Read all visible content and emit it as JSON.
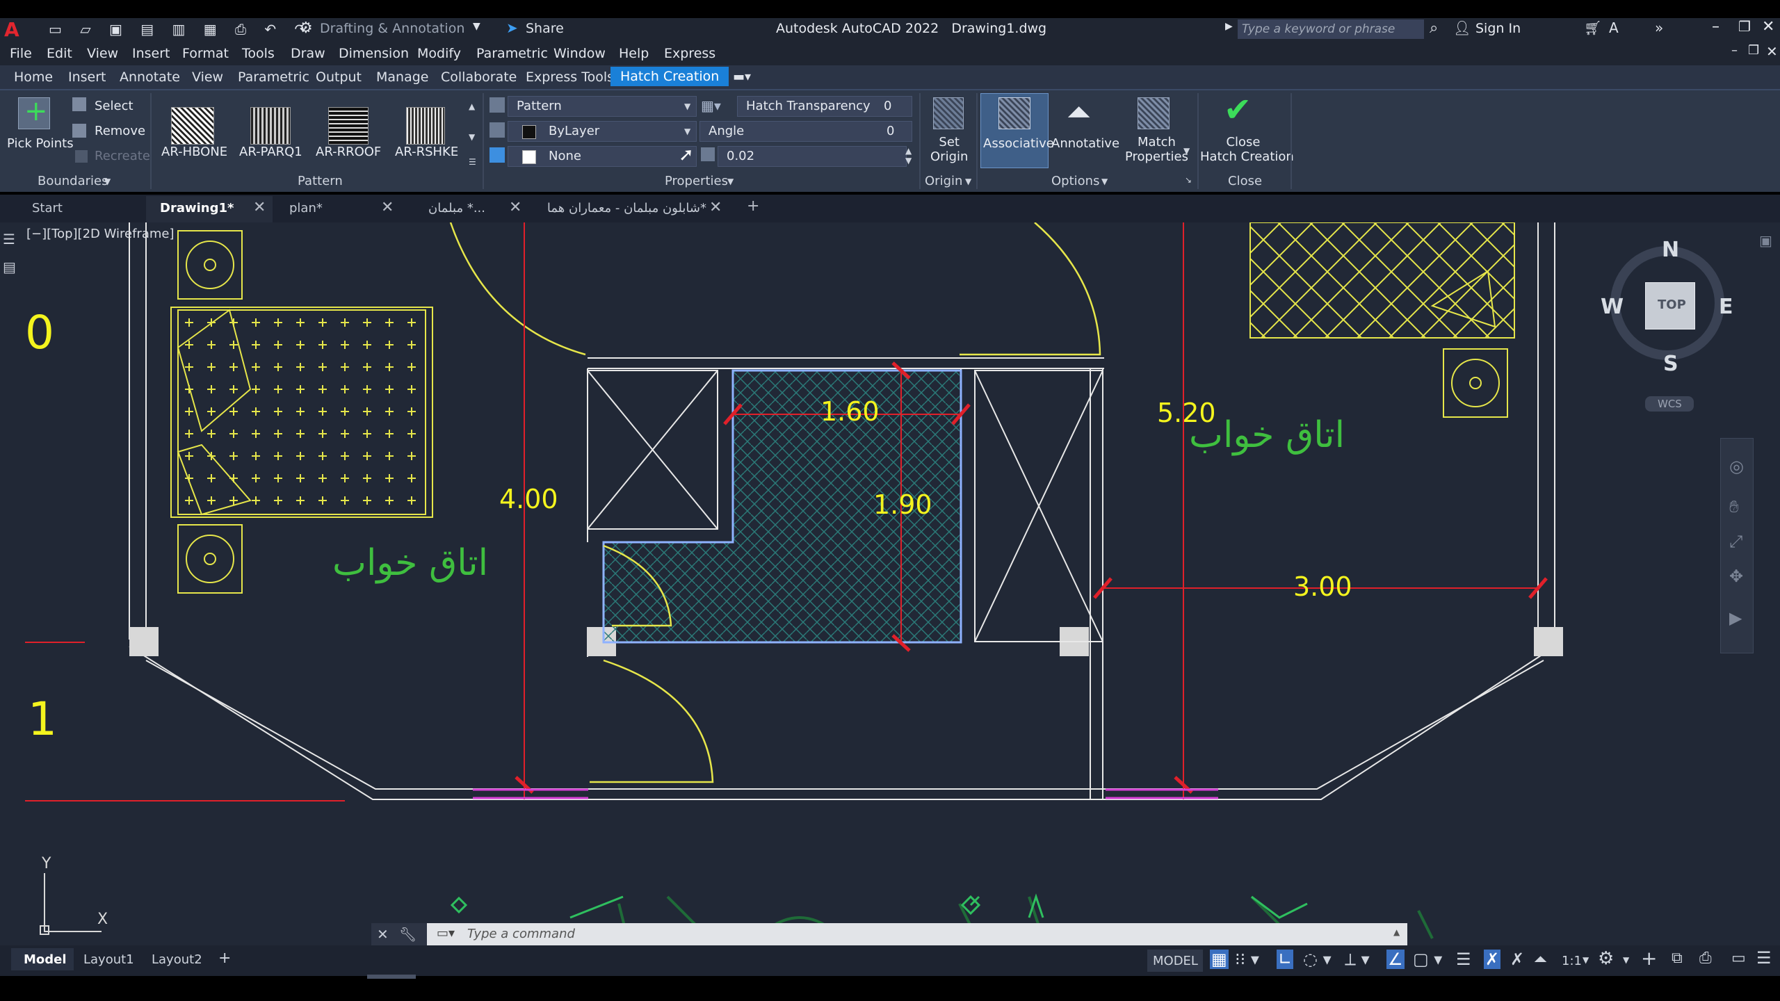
{
  "titlebar": {
    "workspace": "Drafting & Annotation",
    "share": "Share",
    "title": "Autodesk AutoCAD 2022   Drawing1.dwg",
    "search_placeholder": "Type a keyword or phrase",
    "sign_in": "Sign In"
  },
  "menu": [
    "File",
    "Edit",
    "View",
    "Insert",
    "Format",
    "Tools",
    "Draw",
    "Dimension",
    "Modify",
    "Parametric",
    "Window",
    "Help",
    "Express"
  ],
  "ribbon_tabs": [
    "Home",
    "Insert",
    "Annotate",
    "View",
    "Parametric",
    "Output",
    "Manage",
    "Collaborate",
    "Express Tools",
    "Hatch Creation"
  ],
  "boundaries": {
    "pick_points": "Pick Points",
    "select": "Select",
    "remove": "Remove",
    "recreate": "Recreate",
    "title": "Boundaries"
  },
  "pattern": {
    "items": [
      "AR-HBONE",
      "AR-PARQ1",
      "AR-RROOF",
      "AR-RSHKE"
    ],
    "title": "Pattern"
  },
  "properties": {
    "type": "Pattern",
    "color": "ByLayer",
    "background": "None",
    "transparency_label": "Hatch Transparency",
    "transparency_value": "0",
    "angle_label": "Angle",
    "angle_value": "0",
    "scale_value": "0.02",
    "title": "Properties"
  },
  "origin": {
    "set_origin": "Set\nOrigin",
    "title": "Origin"
  },
  "options": {
    "associative": "Associative",
    "annotative": "Annotative",
    "match_properties": "Match\nProperties",
    "title": "Options"
  },
  "close": {
    "label": "Close\nHatch Creation",
    "title": "Close"
  },
  "doc_tabs": [
    "Start",
    "Drawing1*",
    "plan*",
    "...* مبلمان",
    "*شابلون مبلمان - معماران هما"
  ],
  "viewport": {
    "view_label": "[−][Top][2D Wireframe]",
    "layer0": "0",
    "layer1": "1",
    "dims": {
      "d160": "1.60",
      "d190": "1.90",
      "d400": "4.00",
      "d520": "5.20",
      "d300": "3.00"
    },
    "room_label": "اتاق خواب",
    "compass": {
      "n": "N",
      "s": "S",
      "e": "E",
      "w": "W",
      "top": "TOP",
      "wcs": "WCS"
    },
    "ucs": {
      "x": "X",
      "y": "Y"
    }
  },
  "command": {
    "placeholder": "Type a command"
  },
  "status": {
    "layout_tabs": [
      "Model",
      "Layout1",
      "Layout2"
    ],
    "model": "MODEL",
    "scale": "1:1"
  },
  "colors": {
    "accent": "#1a80d8",
    "drawing_yellow": "#e6e64a",
    "dimension_red": "#e0202a",
    "hatch_text": "#f4f41e",
    "room_label_green": "#3fbf3f",
    "magenta": "#d43cd4"
  }
}
